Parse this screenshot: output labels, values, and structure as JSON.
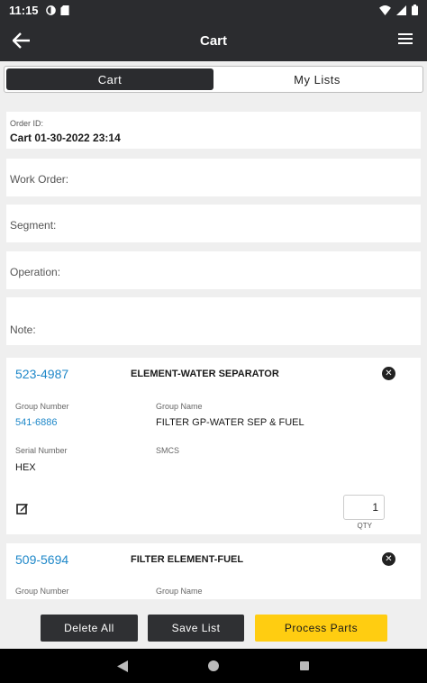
{
  "status": {
    "time": "11:15",
    "icons_left": [
      "sync-icon",
      "sd-card-icon"
    ],
    "icons_right": [
      "wifi-icon",
      "signal-icon",
      "battery-icon"
    ]
  },
  "app_bar": {
    "title": "Cart"
  },
  "tabs": [
    {
      "label": "Cart",
      "active": true
    },
    {
      "label": "My Lists",
      "active": false
    }
  ],
  "order": {
    "id_label": "Order ID:",
    "id_value": "Cart 01-30-2022 23:14"
  },
  "fields": {
    "work_order": "Work Order:",
    "segment": "Segment:",
    "operation": "Operation:",
    "note": "Note:"
  },
  "parts": [
    {
      "part_number": "523-4987",
      "name": "ELEMENT-WATER SEPARATOR",
      "group_number_label": "Group Number",
      "group_number": "541-6886",
      "group_name_label": "Group Name",
      "group_name": "FILTER GP-WATER SEP & FUEL",
      "serial_number_label": "Serial Number",
      "serial_number": "HEX",
      "smcs_label": "SMCS",
      "qty": "1",
      "qty_label": "QTY"
    },
    {
      "part_number": "509-5694",
      "name": "FILTER ELEMENT-FUEL",
      "group_number_label": "Group Number",
      "group_name_label": "Group Name"
    }
  ],
  "actions": {
    "delete_all": "Delete All",
    "save_list": "Save List",
    "process_parts": "Process Parts"
  },
  "colors": {
    "accent": "#ffcd11",
    "link": "#1f88c9",
    "dark": "#2b2c2f"
  }
}
